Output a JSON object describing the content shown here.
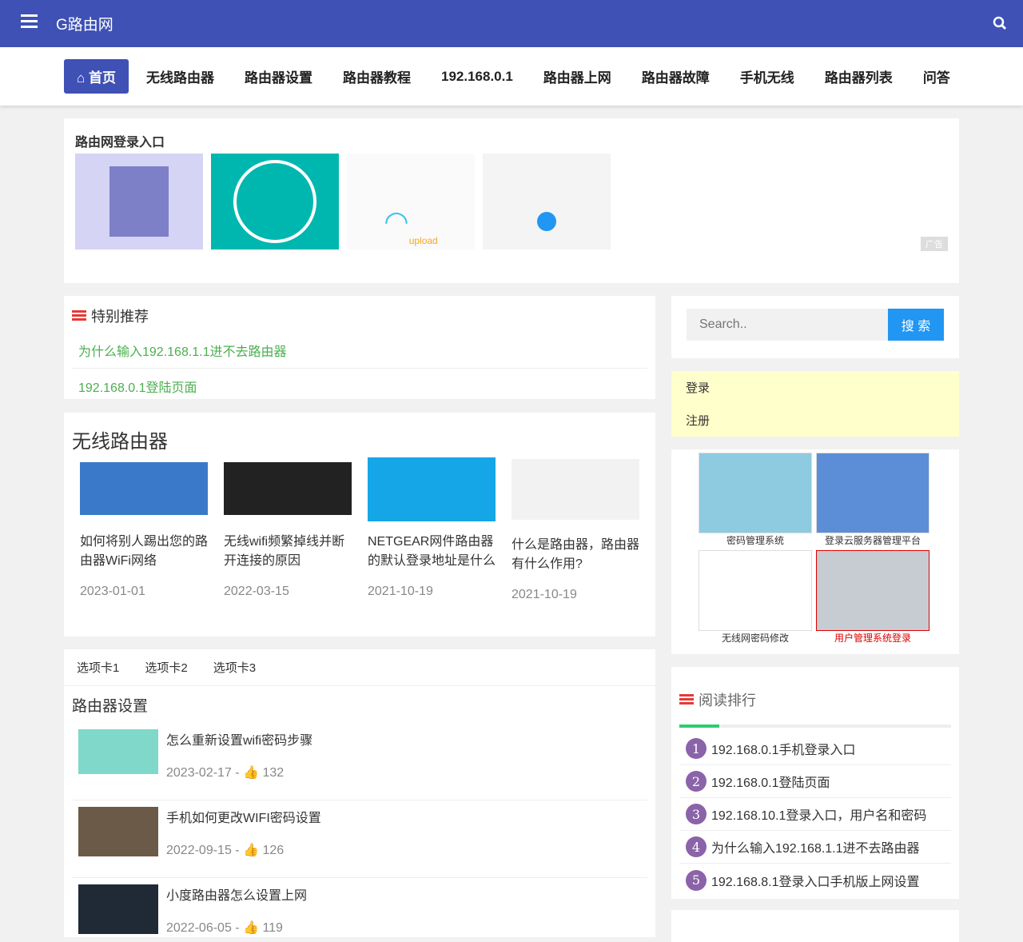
{
  "header": {
    "brand": "G路由网"
  },
  "nav": [
    "首页",
    "无线路由器",
    "路由器设置",
    "路由器教程",
    "192.168.0.1",
    "路由器上网",
    "路由器故障",
    "手机无线",
    "路由器列表",
    "问答"
  ],
  "banner": {
    "title": "路由网登录入口",
    "ad_label": "广告",
    "upload_text": "upload"
  },
  "featured": {
    "title": "特别推荐",
    "links": [
      "为什么输入192.168.1.1进不去路由器",
      "192.168.0.1登陆页面"
    ]
  },
  "wireless": {
    "title": "无线路由器",
    "posts": [
      {
        "title": "如何将别人踢出您的路由器WiFi网络",
        "date": "2023-01-01"
      },
      {
        "title": "无线wifi频繁掉线并断开连接的原因",
        "date": "2022-03-15"
      },
      {
        "title": "NETGEAR网件路由器的默认登录地址是什么",
        "date": "2021-10-19"
      },
      {
        "title": "什么是路由器，路由器有什么作用?",
        "date": "2021-10-19"
      }
    ]
  },
  "tabs": {
    "labels": [
      "选项卡1",
      "选项卡2",
      "选项卡3"
    ],
    "title": "路由器设置",
    "items": [
      {
        "title": "怎么重新设置wifi密码步骤",
        "date": "2023-02-17",
        "likes": "132"
      },
      {
        "title": "手机如何更改WIFI密码设置",
        "date": "2022-09-15",
        "likes": "126"
      },
      {
        "title": "小度路由器怎么设置上网",
        "date": "2022-06-05",
        "likes": "119"
      }
    ]
  },
  "search": {
    "placeholder": "Search..",
    "button": "搜 索"
  },
  "account": {
    "login": "登录",
    "register": "注册"
  },
  "ads": [
    "密码管理系统",
    "登录云服务器管理平台",
    "无线网密码修改",
    "用户管理系统登录"
  ],
  "ranking": {
    "title": "阅读排行",
    "items": [
      "192.168.0.1手机登录入口",
      "192.168.0.1登陆页面",
      "192.168.10.1登录入口，用户名和密码",
      "为什么输入192.168.1.1进不去路由器",
      "192.168.8.1登录入口手机版上网设置"
    ]
  },
  "colors": {
    "primary": "#3f51b5",
    "link": "#4caf50",
    "rank": "#8a63a8"
  }
}
